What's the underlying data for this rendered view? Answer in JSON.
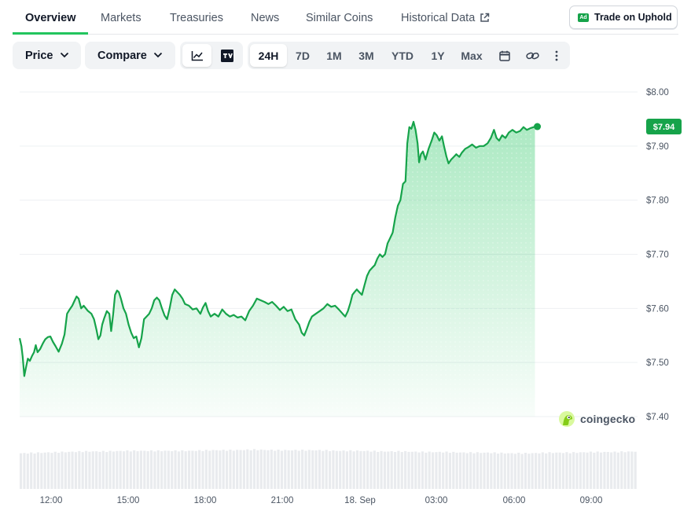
{
  "tabs": [
    {
      "label": "Overview",
      "active": true
    },
    {
      "label": "Markets"
    },
    {
      "label": "Treasuries"
    },
    {
      "label": "News"
    },
    {
      "label": "Similar Coins"
    },
    {
      "label": "Historical Data"
    }
  ],
  "ad": {
    "badge": "Ad",
    "label": "Trade on Uphold"
  },
  "toolbar": {
    "price_label": "Price",
    "compare_label": "Compare",
    "chart_types": [
      "line-chart-icon",
      "tradingview-icon"
    ],
    "ranges": [
      "24H",
      "7D",
      "1M",
      "3M",
      "YTD",
      "1Y",
      "Max"
    ],
    "selected_range": "24H",
    "tools": [
      "calendar-icon",
      "link-icon",
      "more-vertical-icon"
    ]
  },
  "brand": {
    "name": "coingecko"
  },
  "chart_data": {
    "type": "area",
    "x_tick_labels": [
      "12:00",
      "15:00",
      "18:00",
      "21:00",
      "18. Sep",
      "03:00",
      "06:00",
      "09:00"
    ],
    "y_tick_labels": [
      "$7.40",
      "$7.50",
      "$7.60",
      "$7.70",
      "$7.80",
      "$7.90",
      "$8.00"
    ],
    "ylim": [
      7.4,
      8.0
    ],
    "x_range_hours": [
      10.9,
      35.0
    ],
    "grid": true,
    "last_price_label": "$7.94",
    "colors": {
      "line": "#16a34a",
      "badge": "#16a34a"
    },
    "series": [
      {
        "points": [
          [
            10.9,
            7.545
          ],
          [
            10.97,
            7.53
          ],
          [
            11.02,
            7.51
          ],
          [
            11.08,
            7.475
          ],
          [
            11.15,
            7.492
          ],
          [
            11.22,
            7.507
          ],
          [
            11.3,
            7.503
          ],
          [
            11.38,
            7.512
          ],
          [
            11.46,
            7.519
          ],
          [
            11.53,
            7.532
          ],
          [
            11.6,
            7.519
          ],
          [
            11.7,
            7.525
          ],
          [
            11.8,
            7.535
          ],
          [
            11.9,
            7.543
          ],
          [
            12.0,
            7.547
          ],
          [
            12.1,
            7.548
          ],
          [
            12.2,
            7.538
          ],
          [
            12.3,
            7.53
          ],
          [
            12.42,
            7.52
          ],
          [
            12.55,
            7.535
          ],
          [
            12.65,
            7.552
          ],
          [
            12.75,
            7.59
          ],
          [
            12.85,
            7.598
          ],
          [
            12.95,
            7.605
          ],
          [
            13.05,
            7.615
          ],
          [
            13.12,
            7.622
          ],
          [
            13.2,
            7.618
          ],
          [
            13.3,
            7.6
          ],
          [
            13.4,
            7.605
          ],
          [
            13.55,
            7.596
          ],
          [
            13.7,
            7.59
          ],
          [
            13.8,
            7.58
          ],
          [
            13.9,
            7.56
          ],
          [
            13.97,
            7.543
          ],
          [
            14.05,
            7.55
          ],
          [
            14.12,
            7.57
          ],
          [
            14.2,
            7.582
          ],
          [
            14.3,
            7.595
          ],
          [
            14.4,
            7.59
          ],
          [
            14.47,
            7.558
          ],
          [
            14.55,
            7.59
          ],
          [
            14.62,
            7.625
          ],
          [
            14.7,
            7.633
          ],
          [
            14.77,
            7.63
          ],
          [
            14.85,
            7.618
          ],
          [
            14.95,
            7.6
          ],
          [
            15.05,
            7.59
          ],
          [
            15.15,
            7.57
          ],
          [
            15.25,
            7.555
          ],
          [
            15.35,
            7.545
          ],
          [
            15.45,
            7.548
          ],
          [
            15.55,
            7.528
          ],
          [
            15.65,
            7.545
          ],
          [
            15.75,
            7.58
          ],
          [
            15.85,
            7.585
          ],
          [
            15.95,
            7.59
          ],
          [
            16.05,
            7.6
          ],
          [
            16.15,
            7.615
          ],
          [
            16.25,
            7.62
          ],
          [
            16.35,
            7.615
          ],
          [
            16.45,
            7.6
          ],
          [
            16.55,
            7.587
          ],
          [
            16.65,
            7.58
          ],
          [
            16.75,
            7.6
          ],
          [
            16.85,
            7.625
          ],
          [
            16.95,
            7.635
          ],
          [
            17.05,
            7.63
          ],
          [
            17.15,
            7.625
          ],
          [
            17.25,
            7.618
          ],
          [
            17.35,
            7.608
          ],
          [
            17.5,
            7.605
          ],
          [
            17.65,
            7.598
          ],
          [
            17.8,
            7.6
          ],
          [
            17.95,
            7.59
          ],
          [
            18.05,
            7.602
          ],
          [
            18.15,
            7.61
          ],
          [
            18.25,
            7.595
          ],
          [
            18.35,
            7.585
          ],
          [
            18.5,
            7.59
          ],
          [
            18.65,
            7.585
          ],
          [
            18.8,
            7.598
          ],
          [
            18.95,
            7.59
          ],
          [
            19.1,
            7.585
          ],
          [
            19.25,
            7.588
          ],
          [
            19.4,
            7.583
          ],
          [
            19.55,
            7.585
          ],
          [
            19.7,
            7.578
          ],
          [
            19.85,
            7.595
          ],
          [
            20.0,
            7.605
          ],
          [
            20.15,
            7.618
          ],
          [
            20.3,
            7.615
          ],
          [
            20.45,
            7.612
          ],
          [
            20.6,
            7.608
          ],
          [
            20.75,
            7.612
          ],
          [
            20.9,
            7.605
          ],
          [
            21.05,
            7.597
          ],
          [
            21.2,
            7.603
          ],
          [
            21.35,
            7.595
          ],
          [
            21.5,
            7.598
          ],
          [
            21.65,
            7.58
          ],
          [
            21.8,
            7.57
          ],
          [
            21.9,
            7.555
          ],
          [
            22.0,
            7.55
          ],
          [
            22.1,
            7.562
          ],
          [
            22.2,
            7.575
          ],
          [
            22.3,
            7.585
          ],
          [
            22.45,
            7.59
          ],
          [
            22.6,
            7.595
          ],
          [
            22.75,
            7.6
          ],
          [
            22.9,
            7.608
          ],
          [
            23.05,
            7.603
          ],
          [
            23.2,
            7.605
          ],
          [
            23.35,
            7.598
          ],
          [
            23.5,
            7.59
          ],
          [
            23.6,
            7.585
          ],
          [
            23.7,
            7.595
          ],
          [
            23.8,
            7.61
          ],
          [
            23.88,
            7.625
          ],
          [
            23.96,
            7.63
          ],
          [
            24.05,
            7.635
          ],
          [
            24.15,
            7.63
          ],
          [
            24.25,
            7.625
          ],
          [
            24.35,
            7.643
          ],
          [
            24.45,
            7.66
          ],
          [
            24.55,
            7.67
          ],
          [
            24.65,
            7.675
          ],
          [
            24.75,
            7.68
          ],
          [
            24.85,
            7.692
          ],
          [
            24.95,
            7.7
          ],
          [
            25.05,
            7.695
          ],
          [
            25.15,
            7.7
          ],
          [
            25.25,
            7.72
          ],
          [
            25.35,
            7.73
          ],
          [
            25.45,
            7.74
          ],
          [
            25.55,
            7.768
          ],
          [
            25.65,
            7.79
          ],
          [
            25.75,
            7.8
          ],
          [
            25.85,
            7.83
          ],
          [
            25.95,
            7.835
          ],
          [
            26.02,
            7.905
          ],
          [
            26.1,
            7.935
          ],
          [
            26.18,
            7.932
          ],
          [
            26.26,
            7.945
          ],
          [
            26.34,
            7.93
          ],
          [
            26.42,
            7.905
          ],
          [
            26.48,
            7.87
          ],
          [
            26.55,
            7.885
          ],
          [
            26.63,
            7.89
          ],
          [
            26.73,
            7.875
          ],
          [
            26.85,
            7.895
          ],
          [
            26.97,
            7.91
          ],
          [
            27.07,
            7.925
          ],
          [
            27.17,
            7.92
          ],
          [
            27.27,
            7.91
          ],
          [
            27.37,
            7.918
          ],
          [
            27.45,
            7.9
          ],
          [
            27.55,
            7.88
          ],
          [
            27.63,
            7.868
          ],
          [
            27.73,
            7.875
          ],
          [
            27.83,
            7.88
          ],
          [
            27.93,
            7.885
          ],
          [
            28.05,
            7.88
          ],
          [
            28.15,
            7.888
          ],
          [
            28.28,
            7.895
          ],
          [
            28.4,
            7.898
          ],
          [
            28.55,
            7.903
          ],
          [
            28.7,
            7.897
          ],
          [
            28.85,
            7.9
          ],
          [
            29.0,
            7.9
          ],
          [
            29.15,
            7.905
          ],
          [
            29.28,
            7.915
          ],
          [
            29.4,
            7.93
          ],
          [
            29.5,
            7.915
          ],
          [
            29.6,
            7.91
          ],
          [
            29.72,
            7.92
          ],
          [
            29.85,
            7.915
          ],
          [
            29.98,
            7.925
          ],
          [
            30.12,
            7.93
          ],
          [
            30.27,
            7.925
          ],
          [
            30.42,
            7.928
          ],
          [
            30.55,
            7.935
          ],
          [
            30.68,
            7.93
          ],
          [
            30.82,
            7.933
          ],
          [
            30.95,
            7.935
          ],
          [
            31.0,
            7.936
          ]
        ]
      }
    ],
    "volume": {
      "description_free": true,
      "values": [
        0.58,
        0.59,
        0.6,
        0.61,
        0.61,
        0.62,
        0.62,
        0.62,
        0.62,
        0.63,
        0.63,
        0.64,
        0.63,
        0.63,
        0.63,
        0.62,
        0.62,
        0.61,
        0.61,
        0.6,
        0.6,
        0.59,
        0.59,
        0.58,
        0.58,
        0.59,
        0.59,
        0.6,
        0.6,
        0.61
      ]
    }
  }
}
